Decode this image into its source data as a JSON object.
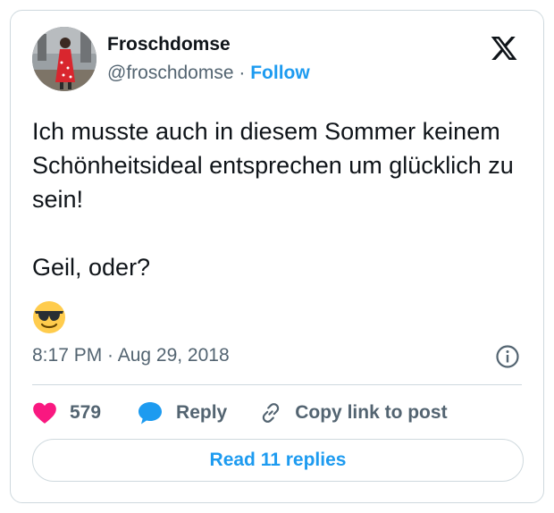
{
  "author": {
    "name": "Froschdomse",
    "handle": "@froschdomse",
    "separator": "·",
    "follow_label": "Follow"
  },
  "tweet": {
    "text": "Ich musste auch in diesem Sommer keinem Schönheitsideal entsprechen um glücklich zu sein!\n\nGeil, oder?",
    "emoji": "smiling-face-with-sunglasses",
    "timestamp": "8:17 PM · Aug 29, 2018"
  },
  "actions": {
    "like_count": "579",
    "reply_label": "Reply",
    "copy_label": "Copy link to post"
  },
  "read_replies_label": "Read 11 replies",
  "icons": {
    "brand": "x-logo-icon",
    "info": "info-icon",
    "like": "heart-icon",
    "reply": "speech-bubble-icon",
    "copy": "link-icon"
  },
  "colors": {
    "accent": "#1d9bf0",
    "like": "#f91880",
    "secondary_text": "#536471",
    "border": "#cfd9de"
  }
}
